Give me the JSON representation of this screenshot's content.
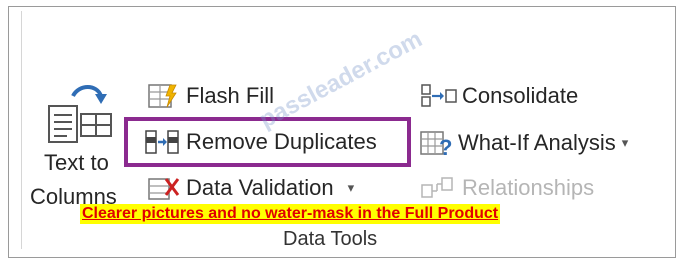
{
  "ribbon": {
    "text_to_columns": {
      "line1": "Text to",
      "line2": "Columns"
    },
    "flash_fill": {
      "label": "Flash Fill"
    },
    "remove_duplicates": {
      "label": "Remove Duplicates"
    },
    "data_validation": {
      "label": "Data Validation",
      "caret": "▾"
    },
    "consolidate": {
      "label": "Consolidate"
    },
    "what_if": {
      "label": "What-If Analysis",
      "caret": "▾"
    },
    "relationships": {
      "label": "Relationships"
    },
    "group_label": "Data Tools"
  },
  "overlay": {
    "promo": "Clearer pictures and no water-mask in the Full Product",
    "watermark": "passleader.com"
  },
  "colors": {
    "highlight_border": "#8b2a8f",
    "promo_background": "#ffff00",
    "promo_text": "#e00000"
  },
  "icons": [
    "text-to-columns-icon",
    "flash-fill-icon",
    "remove-duplicates-icon",
    "data-validation-icon",
    "consolidate-icon",
    "what-if-analysis-icon",
    "relationships-icon"
  ]
}
